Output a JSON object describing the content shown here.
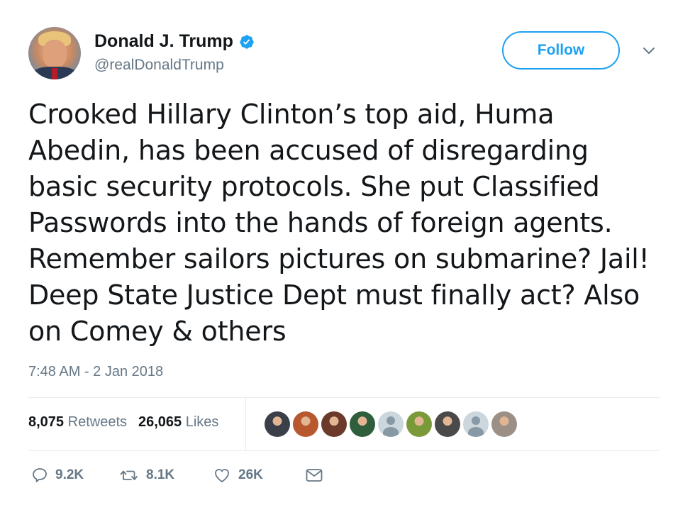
{
  "user": {
    "display_name": "Donald J. Trump",
    "handle": "@realDonaldTrump",
    "verified_icon": "verified-badge-icon"
  },
  "follow_label": "Follow",
  "tweet": {
    "lines": [
      "Crooked Hillary Clinton’s top aid, Huma",
      "Abedin, has been accused of disregarding",
      "basic security protocols. She put Classified",
      "Passwords into the hands of foreign agents.",
      "Remember sailors pictures on submarine? Jail!",
      "Deep State Justice Dept must finally act? Also",
      "on Comey & others"
    ],
    "timestamp": "7:48 AM - 2 Jan 2018"
  },
  "stats": {
    "retweets_count": "8,075",
    "retweets_label": "Retweets",
    "likes_count": "26,065",
    "likes_label": "Likes"
  },
  "liker_avatars": [
    {
      "kind": "photo",
      "color": "#3a3f4a"
    },
    {
      "kind": "photo",
      "color": "#b7582f"
    },
    {
      "kind": "photo",
      "color": "#6b3a2a"
    },
    {
      "kind": "photo",
      "color": "#2e5e3c"
    },
    {
      "kind": "default",
      "color": "#ccd6dd"
    },
    {
      "kind": "photo",
      "color": "#7a9a3a"
    },
    {
      "kind": "photo",
      "color": "#4a4a4a"
    },
    {
      "kind": "default",
      "color": "#ccd6dd"
    },
    {
      "kind": "photo",
      "color": "#9c8f86"
    }
  ],
  "actions": {
    "reply_count": "9.2K",
    "retweet_count": "8.1K",
    "like_count": "26K"
  },
  "colors": {
    "accent": "#1da1f2",
    "muted": "#657786",
    "text": "#14171a",
    "divider": "#e6ecf0"
  }
}
